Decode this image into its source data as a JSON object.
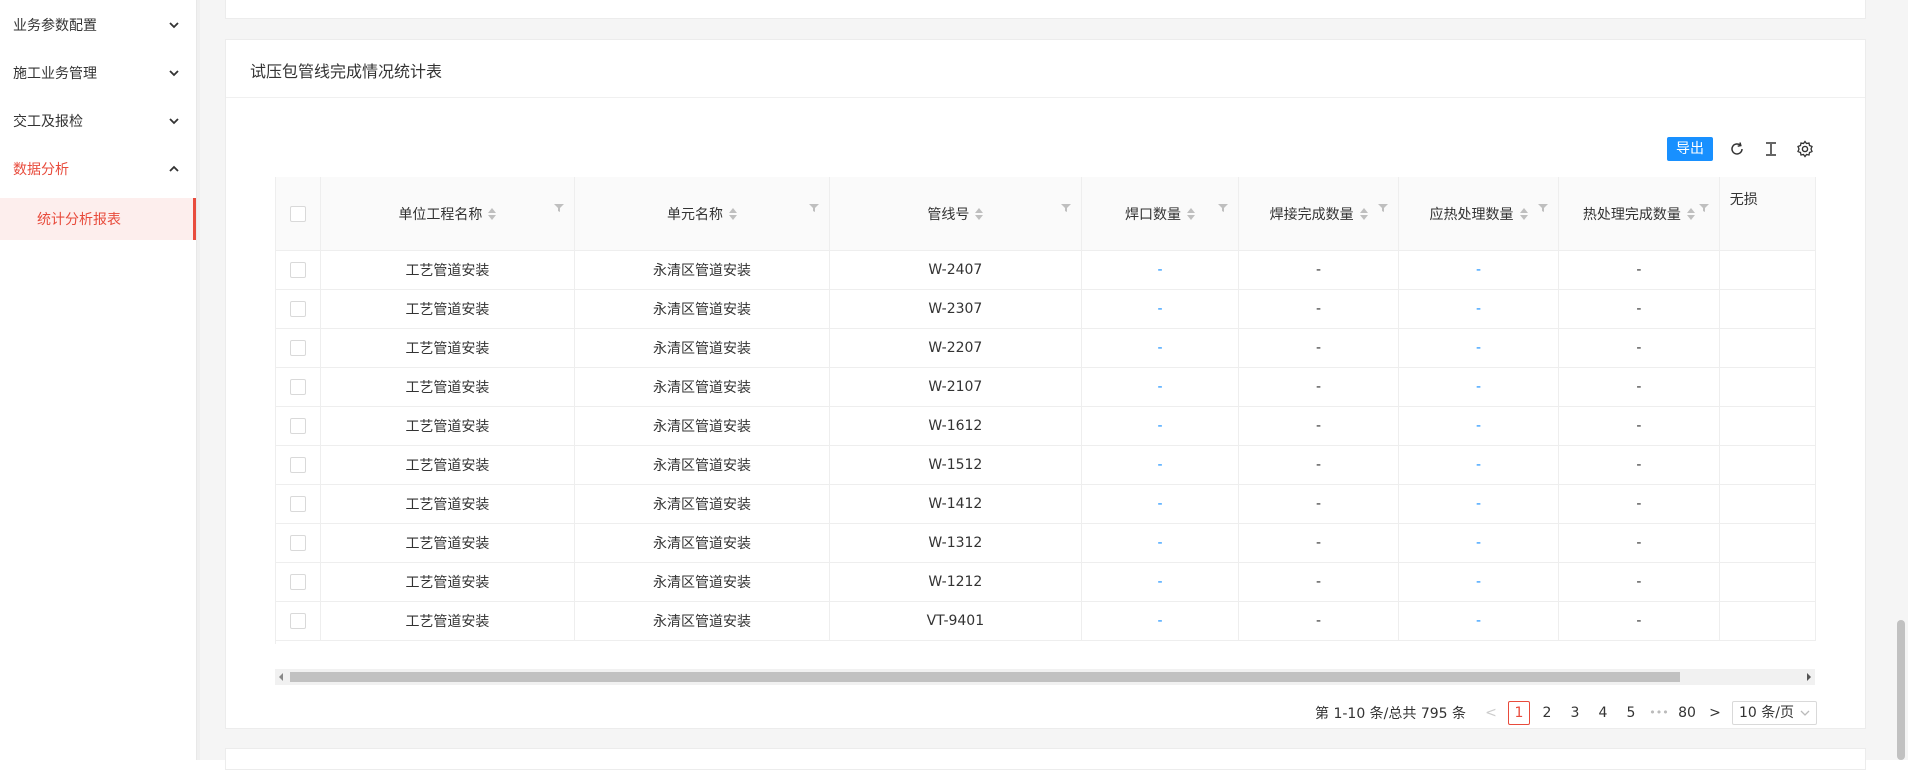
{
  "sidebar": {
    "items": [
      {
        "label": "业务参数配置",
        "expanded": false
      },
      {
        "label": "施工业务管理",
        "expanded": false
      },
      {
        "label": "交工及报检",
        "expanded": false
      },
      {
        "label": "数据分析",
        "expanded": true
      }
    ],
    "sub_items": [
      {
        "label": "统计分析报表"
      }
    ]
  },
  "card": {
    "title": "试压包管线完成情况统计表"
  },
  "toolbar": {
    "export_label": "导出",
    "icons": [
      "refresh-icon",
      "column-height-icon",
      "settings-icon"
    ]
  },
  "table": {
    "columns": [
      "单位工程名称",
      "单元名称",
      "管线号",
      "焊口数量",
      "焊接完成数量",
      "应热处理数量",
      "热处理完成数量",
      "无损"
    ],
    "rows": [
      [
        "工艺管道安装",
        "永清区管道安装",
        "W-2407",
        "-",
        "-",
        "-",
        "-"
      ],
      [
        "工艺管道安装",
        "永清区管道安装",
        "W-2307",
        "-",
        "-",
        "-",
        "-"
      ],
      [
        "工艺管道安装",
        "永清区管道安装",
        "W-2207",
        "-",
        "-",
        "-",
        "-"
      ],
      [
        "工艺管道安装",
        "永清区管道安装",
        "W-2107",
        "-",
        "-",
        "-",
        "-"
      ],
      [
        "工艺管道安装",
        "永清区管道安装",
        "W-1612",
        "-",
        "-",
        "-",
        "-"
      ],
      [
        "工艺管道安装",
        "永清区管道安装",
        "W-1512",
        "-",
        "-",
        "-",
        "-"
      ],
      [
        "工艺管道安装",
        "永清区管道安装",
        "W-1412",
        "-",
        "-",
        "-",
        "-"
      ],
      [
        "工艺管道安装",
        "永清区管道安装",
        "W-1312",
        "-",
        "-",
        "-",
        "-"
      ],
      [
        "工艺管道安装",
        "永清区管道安装",
        "W-1212",
        "-",
        "-",
        "-",
        "-"
      ],
      [
        "工艺管道安装",
        "永清区管道安装",
        "VT-9401",
        "-",
        "-",
        "-",
        "-"
      ]
    ]
  },
  "pagination": {
    "summary": "第 1-10 条/总共 795 条",
    "prev": "<",
    "next": ">",
    "pages": [
      "1",
      "2",
      "3",
      "4",
      "5"
    ],
    "ellipsis": "•••",
    "last_page": "80",
    "current": "1",
    "page_size": "10 条/页"
  },
  "colors": {
    "accent": "#e84b3c",
    "primary": "#1890ff"
  }
}
